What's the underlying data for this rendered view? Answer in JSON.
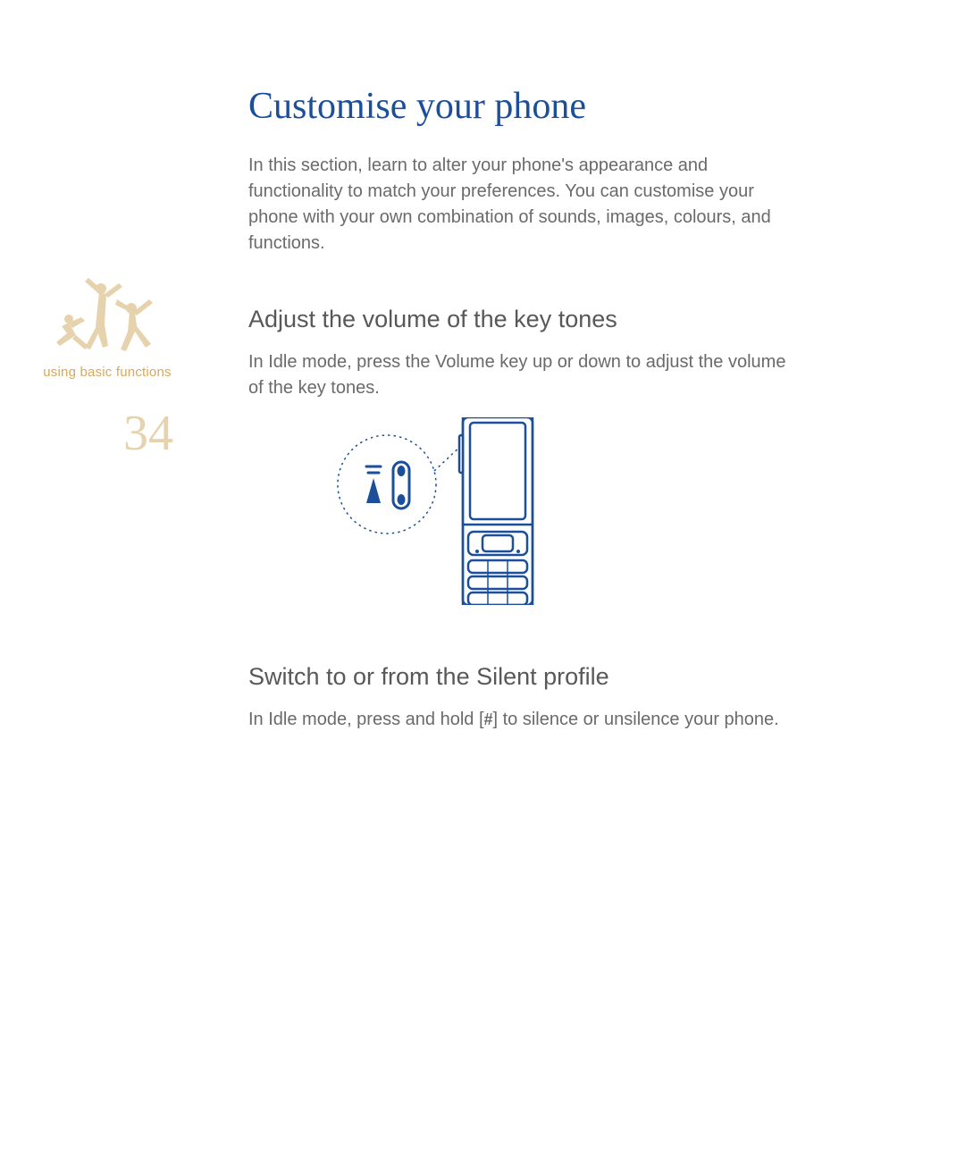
{
  "sidebar": {
    "caption": "using basic functions",
    "page_number": "34"
  },
  "content": {
    "title": "Customise your phone",
    "intro": "In this section, learn to alter your phone's appearance and functionality to match your preferences. You can customise your phone with your own combination of sounds, images, colours, and functions.",
    "section1": {
      "heading": "Adjust the volume of the key tones",
      "body": "In Idle mode, press the Volume key up or down to adjust the volume of the key tones."
    },
    "section2": {
      "heading": "Switch to or from the Silent profile",
      "body_pre": "In Idle mode, press and hold [",
      "hash": "#",
      "body_post": "] to silence or unsilence your phone."
    }
  }
}
